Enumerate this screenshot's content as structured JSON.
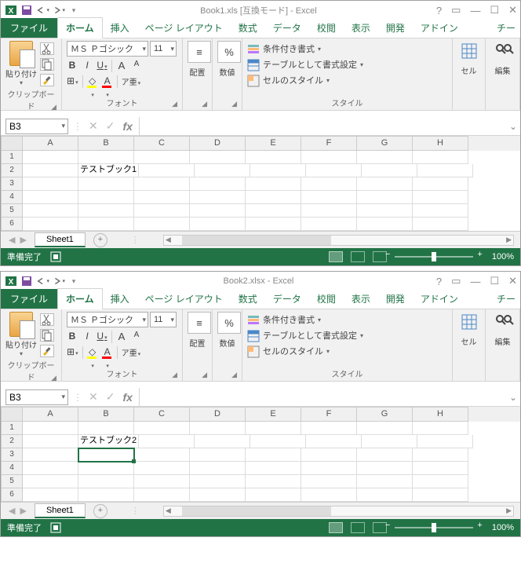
{
  "windows": [
    {
      "title": "Book1.xls  [互換モード] - Excel",
      "namebox": "B3",
      "sheet": "Sheet1",
      "status": "準備完了",
      "zoom": "100%",
      "cells": {
        "B2": "テストブック1"
      },
      "selected": null
    },
    {
      "title": "Book2.xlsx - Excel",
      "namebox": "B3",
      "sheet": "Sheet1",
      "status": "準備完了",
      "zoom": "100%",
      "cells": {
        "B2": "テストブック2"
      },
      "selected": "B3"
    }
  ],
  "tabs": {
    "file": "ファイル",
    "home": "ホーム",
    "insert": "挿入",
    "pagelayout": "ページ レイアウト",
    "formulas": "数式",
    "data": "データ",
    "review": "校閲",
    "view": "表示",
    "developer": "開発",
    "addins": "アドイン",
    "team": "チー"
  },
  "ribbon": {
    "clipboard": {
      "paste": "貼り付け",
      "label": "クリップボード"
    },
    "font": {
      "name": "ＭＳ Ｐゴシック",
      "size": "11",
      "label": "フォント",
      "bold": "B",
      "italic": "I",
      "underline": "U",
      "ruby": "ア亜",
      "grow": "A",
      "shrink": "A",
      "border": "⊞",
      "fill": "◇",
      "color": "A"
    },
    "align": {
      "label": "配置",
      "icon": "≡"
    },
    "number": {
      "label": "数値",
      "icon": "%"
    },
    "styles": {
      "cond": "条件付き書式",
      "table": "テーブルとして書式設定",
      "cell": "セルのスタイル",
      "label": "スタイル"
    },
    "cells": {
      "label": "セル"
    },
    "editing": {
      "label": "編集"
    }
  },
  "columns": [
    "A",
    "B",
    "C",
    "D",
    "E",
    "F",
    "G",
    "H"
  ],
  "rows": [
    "1",
    "2",
    "3",
    "4",
    "5",
    "6"
  ]
}
